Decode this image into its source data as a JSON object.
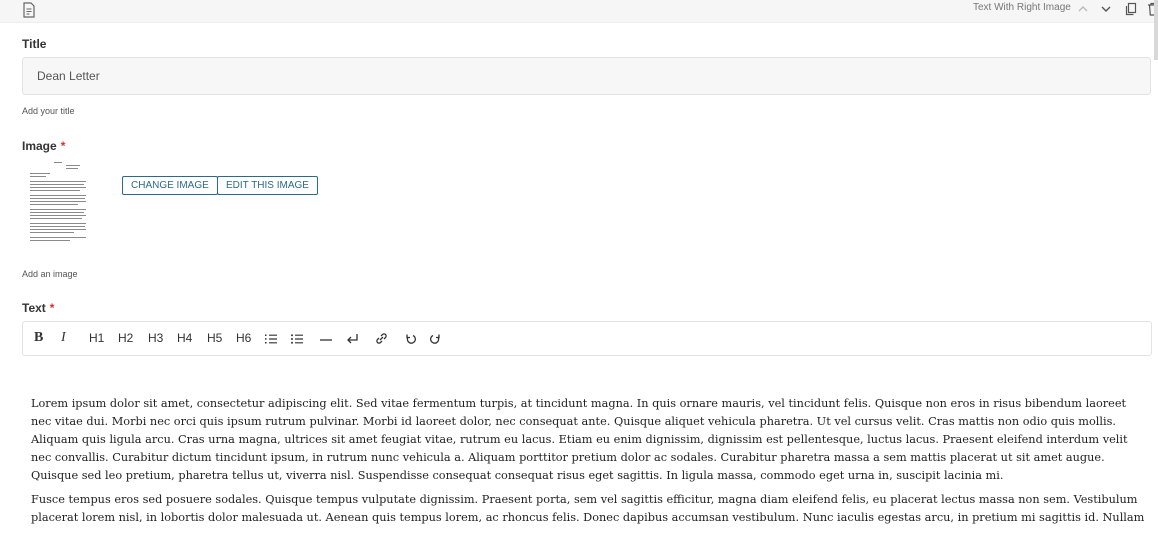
{
  "header": {
    "block_type": "Text With Right Image",
    "icons": [
      "document-icon",
      "chevron-up-icon",
      "chevron-down-icon",
      "copy-icon",
      "delete-icon"
    ]
  },
  "title_field": {
    "label": "Title",
    "value": "Dean Letter",
    "help": "Add your title"
  },
  "image_field": {
    "label": "Image",
    "required_mark": "*",
    "change_button": "CHANGE IMAGE",
    "edit_button": "EDIT THIS IMAGE",
    "help": "Add an image"
  },
  "text_field": {
    "label": "Text",
    "required_mark": "*",
    "toolbar": {
      "bold": "B",
      "italic": "I",
      "h1": "H1",
      "h2": "H2",
      "h3": "H3",
      "h4": "H4",
      "h5": "H5",
      "h6": "H6",
      "ordered_list": "⁝≡",
      "bullet_list": "⁚≡",
      "horizontal_rule": "—",
      "hard_break": "↵",
      "link": "🔗",
      "undo": "↺",
      "redo": "↻"
    },
    "paragraphs": [
      "Lorem ipsum dolor sit amet, consectetur adipiscing elit. Sed vitae fermentum turpis, at tincidunt magna. In quis ornare mauris, vel tincidunt felis. Quisque non eros in risus bibendum laoreet nec vitae dui. Morbi nec orci quis ipsum rutrum pulvinar. Morbi id laoreet dolor, nec consequat ante. Quisque aliquet vehicula pharetra. Ut vel cursus velit. Cras mattis non odio quis mollis. Aliquam quis ligula arcu. Cras urna magna, ultrices sit amet feugiat vitae, rutrum eu lacus. Etiam eu enim dignissim, dignissim est pellentesque, luctus lacus. Praesent eleifend interdum velit nec convallis. Curabitur dictum tincidunt ipsum, in rutrum nunc vehicula a. Aliquam porttitor pretium dolor ac sodales. Curabitur pharetra massa a sem mattis placerat ut sit amet augue. Quisque sed leo pretium, pharetra tellus ut, viverra nisl. Suspendisse consequat consequat risus eget sagittis. In ligula massa, commodo eget urna in, suscipit lacinia mi.",
      "Fusce tempus eros sed posuere sodales. Quisque tempus vulputate dignissim. Praesent porta, sem vel sagittis efficitur, magna diam eleifend felis, eu placerat lectus massa non sem. Vestibulum placerat lorem nisl, in lobortis dolor malesuada ut. Aenean quis tempus lorem, ac rhoncus felis. Donec dapibus accumsan vestibulum. Nunc iaculis egestas arcu, in pretium mi sagittis id. Nullam"
    ]
  },
  "colors": {
    "accent": "#2b6a8a",
    "required": "#d93025",
    "input_bg": "#f7f7f7",
    "border": "#e3e3e3"
  }
}
